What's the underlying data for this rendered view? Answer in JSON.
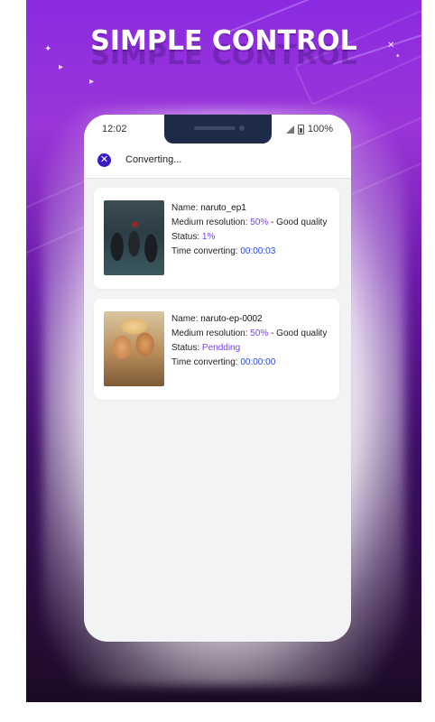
{
  "promo": {
    "headline": "SIMPLE CONTROL"
  },
  "status_bar": {
    "time": "12:02",
    "battery": "100%"
  },
  "app_bar": {
    "title": "Converting..."
  },
  "items": [
    {
      "name_label": "Name:",
      "name": "naruto_ep1",
      "resolution_label": "Medium resolution:",
      "resolution_value": "50%",
      "quality": "- Good quality",
      "status_label": "Status:",
      "status_value": "1%",
      "time_label": "Time converting:",
      "time_value": "00:00:03"
    },
    {
      "name_label": "Name:",
      "name": "naruto-ep-0002",
      "resolution_label": "Medium resolution:",
      "resolution_value": "50%",
      "quality": "- Good quality",
      "status_label": "Status:",
      "status_value": "Pendding",
      "time_label": "Time converting:",
      "time_value": "00:00:00"
    }
  ],
  "colors": {
    "accent_purple": "#7a3ff0",
    "accent_blue": "#2a48d8",
    "close_button": "#3b1cc4"
  }
}
